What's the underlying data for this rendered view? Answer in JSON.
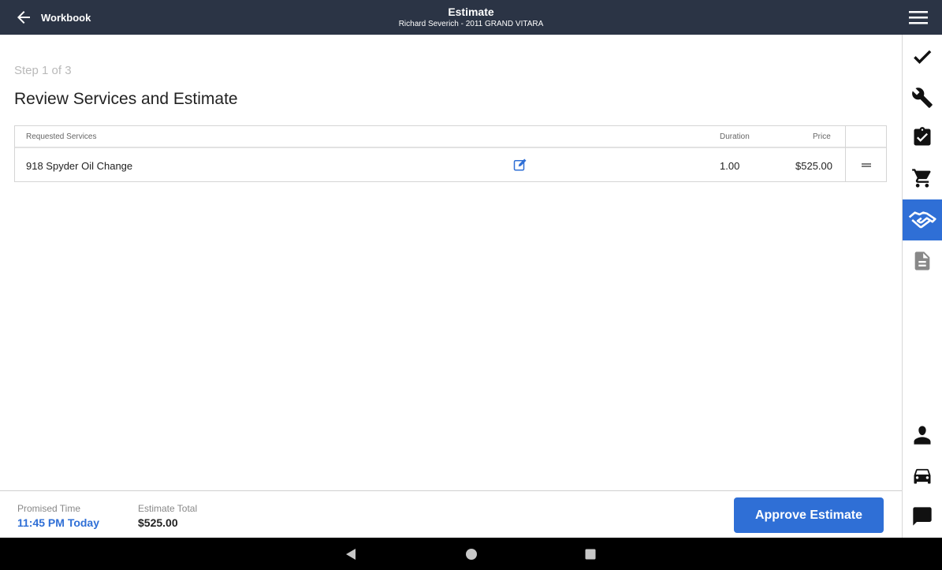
{
  "header": {
    "back_label": "Workbook",
    "title": "Estimate",
    "subtitle": "Richard Severich - 2011 GRAND VITARA"
  },
  "sidebar": {
    "items": [
      {
        "icon": "check-icon"
      },
      {
        "icon": "wrench-icon"
      },
      {
        "icon": "clipboard-check-icon"
      },
      {
        "icon": "cart-icon"
      },
      {
        "icon": "handshake-icon",
        "active": true
      },
      {
        "icon": "document-icon"
      },
      {
        "icon": "person-icon"
      },
      {
        "icon": "car-icon"
      },
      {
        "icon": "chat-icon"
      }
    ],
    "active_color": "#2f6fd6"
  },
  "main": {
    "step": "Step 1 of 3",
    "heading": "Review Services and Estimate",
    "table": {
      "columns": {
        "service": "Requested Services",
        "duration": "Duration",
        "price": "Price"
      },
      "rows": [
        {
          "service": "918 Spyder Oil Change",
          "duration": "1.00",
          "price": "$525.00"
        }
      ]
    }
  },
  "footer": {
    "promised_label": "Promised Time",
    "promised_value": "11:45 PM Today",
    "total_label": "Estimate Total",
    "total_value": "$525.00",
    "approve_label": "Approve Estimate"
  },
  "colors": {
    "header_bg": "#2b3445",
    "accent": "#2f6fd6"
  }
}
